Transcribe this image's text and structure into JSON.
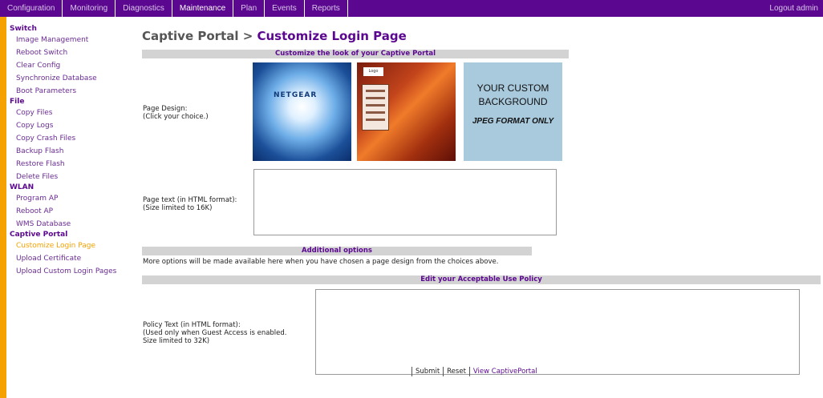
{
  "nav": {
    "tabs": [
      "Configuration",
      "Monitoring",
      "Diagnostics",
      "Maintenance",
      "Plan",
      "Events",
      "Reports"
    ],
    "active_tab": "Maintenance",
    "logout": "Logout admin"
  },
  "sidebar": {
    "switch": {
      "heading": "Switch",
      "items": [
        "Image Management",
        "Reboot Switch",
        "Clear Config",
        "Synchronize Database",
        "Boot Parameters"
      ]
    },
    "file": {
      "heading": "File",
      "items": [
        "Copy Files",
        "Copy Logs",
        "Copy Crash Files",
        "Backup Flash",
        "Restore Flash",
        "Delete Files"
      ]
    },
    "wlan": {
      "heading": "WLAN",
      "items": [
        "Program AP",
        "Reboot AP",
        "WMS Database"
      ]
    },
    "captive": {
      "heading": "Captive Portal",
      "items": [
        "Customize Login Page",
        "Upload Certificate",
        "Upload Custom Login Pages"
      ]
    }
  },
  "page": {
    "breadcrumb_parent": "Captive Portal",
    "breadcrumb_sep": " > ",
    "breadcrumb_current": "Customize Login Page"
  },
  "look": {
    "header": "Customize the look of your Captive Portal",
    "page_design_label": "Page Design:\n(Click your choice.)",
    "thumb1_brand": "NETGEAR",
    "thumb2_logo": "Logo",
    "thumb3_line1": "YOUR CUSTOM",
    "thumb3_line2": "BACKGROUND",
    "thumb3_line3": "JPEG FORMAT ONLY",
    "page_text_label": "Page text (in HTML format):\n(Size limited to 16K)"
  },
  "additional": {
    "header": "Additional options",
    "note": "More options will be made available here when you have chosen a page design from the choices above."
  },
  "policy": {
    "header": "Edit your Acceptable Use Policy",
    "label": "Policy Text (in HTML format):\n(Used only when Guest Access is enabled.\nSize limited to 32K)"
  },
  "buttons": {
    "submit": "Submit",
    "reset": "Reset",
    "view": "View CaptivePortal"
  },
  "colors": {
    "nav_bg": "#5b078f",
    "accent": "#f5a100",
    "header_bg": "#d3d3d3"
  }
}
